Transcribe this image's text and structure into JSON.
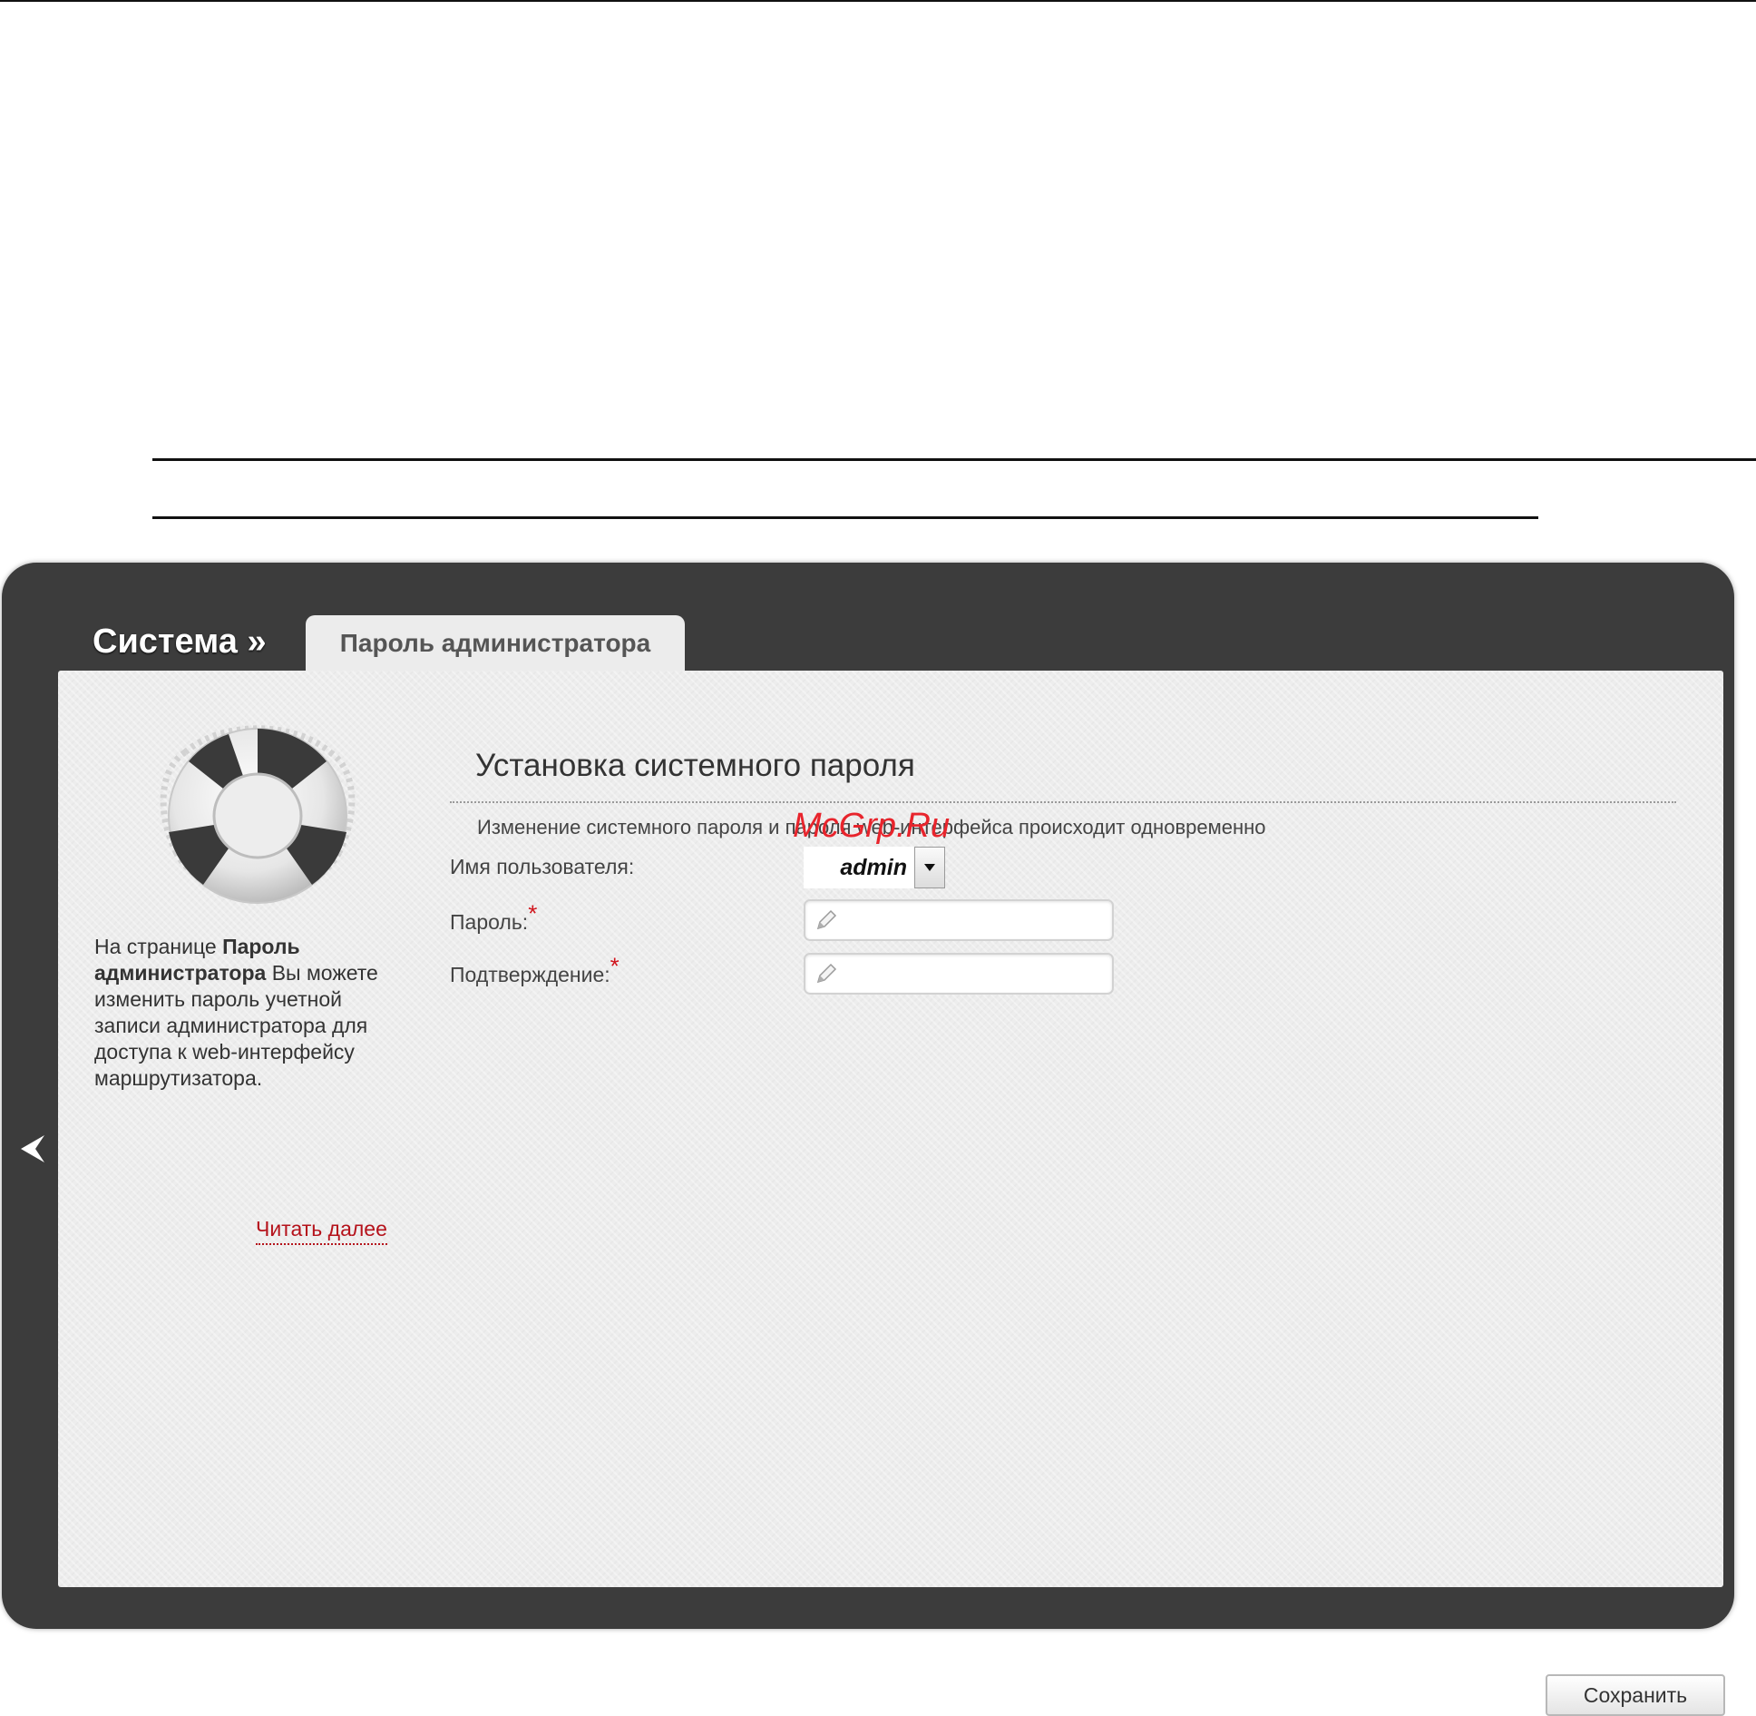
{
  "header": {
    "breadcrumb": "Система »",
    "active_tab": "Пароль администратора"
  },
  "sidebar": {
    "help_intro": "На странице ",
    "help_bold": "Пароль администратора",
    "help_rest": " Вы можете изменить пароль учетной записи администратора для доступа к web-интерфейсу маршрутизатора.",
    "read_more": "Читать далее"
  },
  "form": {
    "title": "Установка системного пароля",
    "description": "Изменение системного пароля и пароля web-интерфейса происходит одновременно",
    "username_label": "Имя пользователя:",
    "username_value": "admin",
    "password_label": "Пароль:",
    "confirm_label": "Подтверждение:",
    "required_mark": "*",
    "password_value": "",
    "confirm_value": ""
  },
  "watermark": "McGrp.Ru",
  "footer": {
    "save_label": "Сохранить"
  },
  "icons": {
    "lifebuoy": "lifebuoy-icon",
    "back": "chevron-left-icon",
    "dropdown": "caret-down-icon",
    "pencil": "pencil-icon"
  },
  "colors": {
    "frame": "#3c3c3c",
    "content_bg": "#ededed",
    "link": "#b5121b",
    "required": "#d0141c"
  }
}
